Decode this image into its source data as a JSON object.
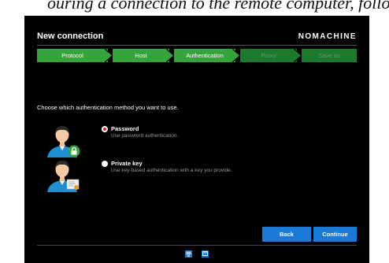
{
  "banner": {
    "text": "ouring a connection to the remote computer, follow this sequence of steps:"
  },
  "window": {
    "title": "New connection",
    "logo": "NOMACHINE"
  },
  "steps": [
    {
      "label": "Protocol",
      "state": "done"
    },
    {
      "label": "Host",
      "state": "done"
    },
    {
      "label": "Authentication",
      "state": "current"
    },
    {
      "label": "Proxy",
      "state": "pending"
    },
    {
      "label": "Save as",
      "state": "pending"
    }
  ],
  "prompt": "Choose which authentication method you want to use.",
  "options": [
    {
      "label": "Password",
      "description": "Use password authentication.",
      "selected": true,
      "icon": "user-lock-icon"
    },
    {
      "label": "Private key",
      "description": "Use key-based authentication with a key you provide.",
      "selected": false,
      "icon": "user-certificate-icon"
    }
  ],
  "buttons": {
    "back": "Back",
    "continue": "Continue"
  },
  "footer_icons": [
    "monitor-icon",
    "window-icon"
  ],
  "colors": {
    "accent_green": "#35a43a",
    "pending_green": "#1c7a2c",
    "button_blue": "#1a78d6",
    "radio_red": "#e0222a",
    "background": "#000000"
  }
}
